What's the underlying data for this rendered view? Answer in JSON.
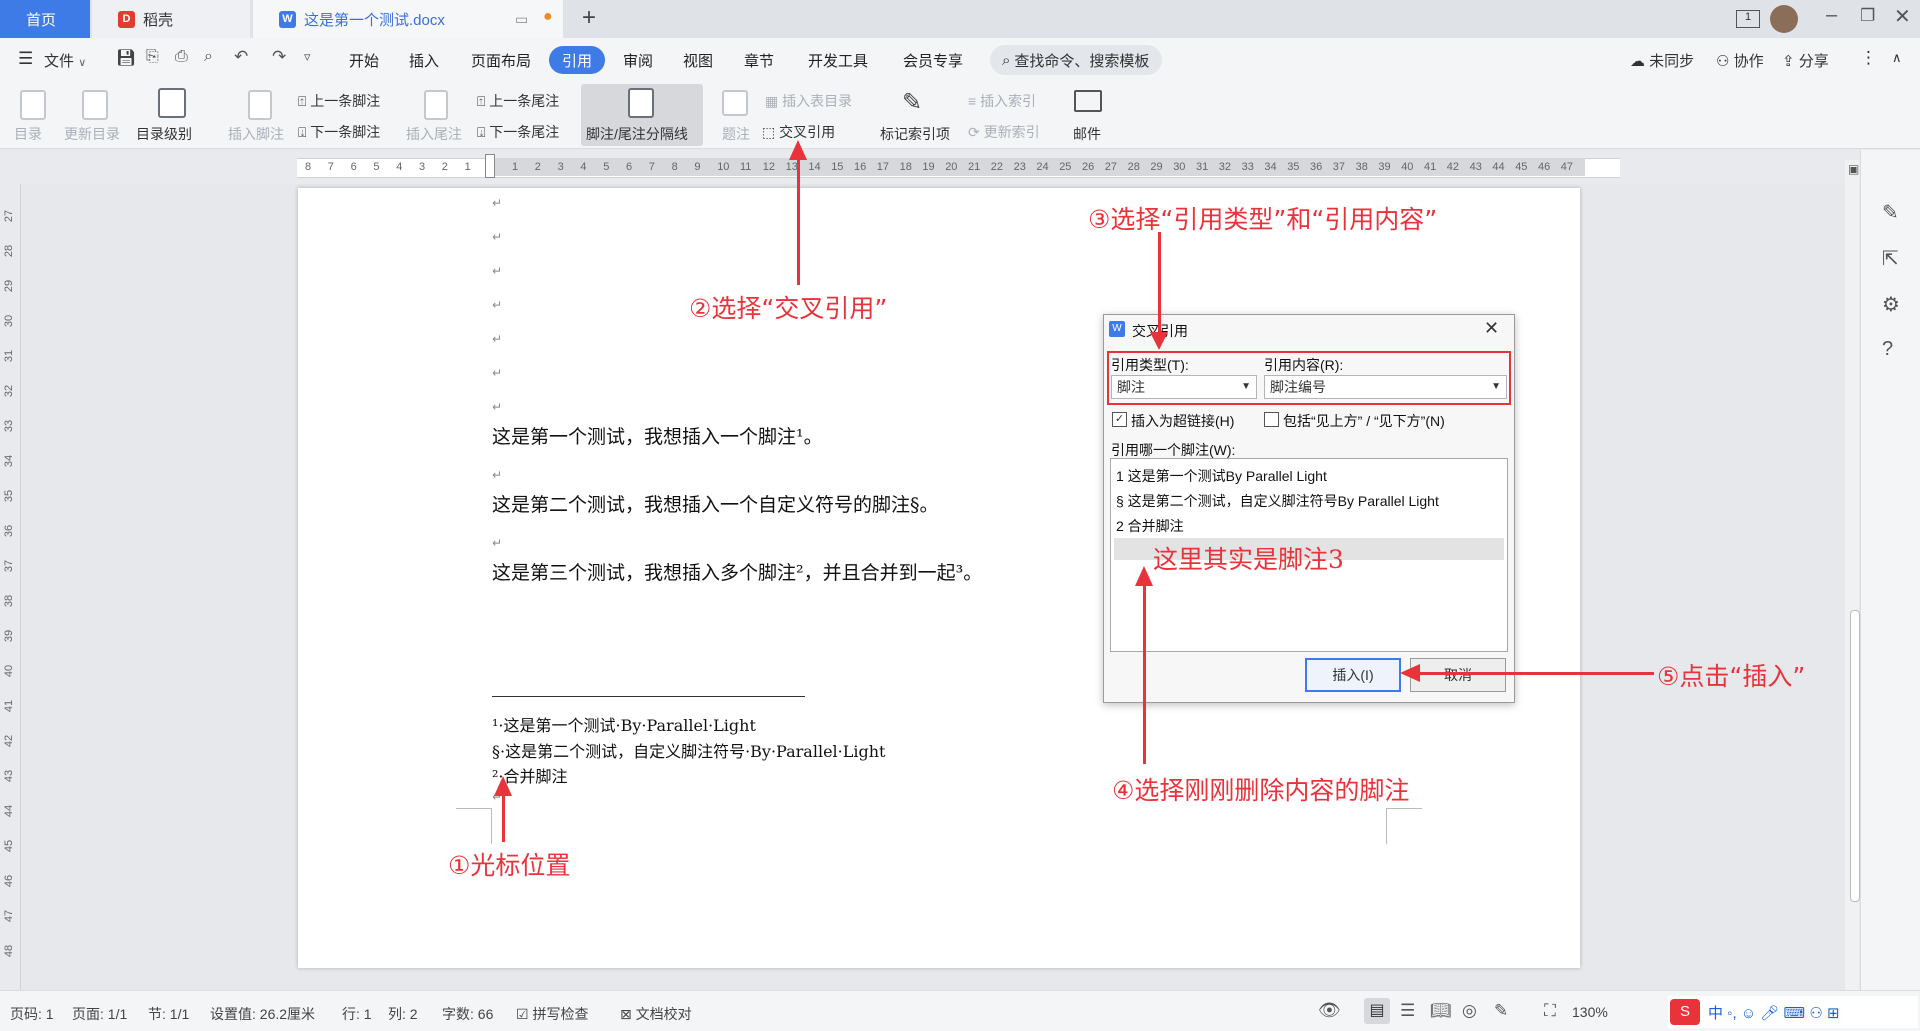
{
  "tabs": {
    "home": "首页",
    "daoke": "稻壳",
    "doc": "这是第一个测试.docx"
  },
  "menubar": {
    "file": "文件",
    "items": [
      "开始",
      "插入",
      "页面布局",
      "引用",
      "审阅",
      "视图",
      "章节",
      "开发工具",
      "会员专享"
    ],
    "search": "查找命令、搜索模板",
    "sync": "未同步",
    "collab": "协作",
    "share": "分享"
  },
  "ribbon": {
    "toc": "目录",
    "update_toc": "更新目录",
    "toc_level": "目录级别",
    "insert_footnote": "插入脚注",
    "prev_footnote": "上一条脚注",
    "next_footnote": "下一条脚注",
    "insert_endnote": "插入尾注",
    "prev_endnote": "上一条尾注",
    "next_endnote": "下一条尾注",
    "separator": "脚注/尾注分隔线",
    "caption": "题注",
    "insert_table_toc": "插入表目录",
    "cross_ref": "交叉引用",
    "mark_index": "标记索引项",
    "insert_index": "插入索引",
    "update_index": "更新索引",
    "mail": "邮件"
  },
  "ruler_left": [
    "8",
    "7",
    "6",
    "5",
    "4",
    "3",
    "2",
    "1"
  ],
  "ruler_right": [
    "1",
    "2",
    "3",
    "4",
    "5",
    "6",
    "7",
    "8",
    "9",
    "10",
    "11",
    "12",
    "13",
    "14",
    "15",
    "16",
    "17",
    "18",
    "19",
    "20",
    "21",
    "22",
    "23",
    "24",
    "25",
    "26",
    "27",
    "28",
    "29",
    "30",
    "31",
    "32",
    "33",
    "34",
    "35",
    "36",
    "37",
    "38",
    "39",
    "40",
    "41",
    "42",
    "43",
    "44",
    "45",
    "46",
    "47"
  ],
  "vruler": [
    "27",
    "28",
    "29",
    "30",
    "31",
    "32",
    "33",
    "34",
    "35",
    "36",
    "37",
    "38",
    "39",
    "40",
    "41",
    "42",
    "43",
    "44",
    "45",
    "46",
    "47",
    "48"
  ],
  "document": {
    "line1": "这是第一个测试，我想插入一个脚注¹。",
    "line2": "这是第二个测试，我想插入一个自定义符号的脚注§。",
    "line3": "这是第三个测试，我想插入多个脚注²，并且合并到一起³。",
    "fn1": "¹·这是第一个测试·By·Parallel·Light",
    "fn2": "§·这是第二个测试，自定义脚注符号·By·Parallel·Light",
    "fn3": "²·合并脚注"
  },
  "dialog": {
    "title": "交叉引用",
    "ref_type_label": "引用类型(T):",
    "ref_type_value": "脚注",
    "ref_content_label": "引用内容(R):",
    "ref_content_value": "脚注编号",
    "hyperlink": "插入为超链接(H)",
    "above_below": "包括“见上方” / “见下方”(N)",
    "which_label": "引用哪一个脚注(W):",
    "items": [
      "1 这是第一个测试By Parallel Light",
      "§ 这是第二个测试，自定义脚注符号By Parallel Light",
      "2 合并脚注"
    ],
    "insert": "插入(I)",
    "cancel": "取消"
  },
  "annotations": {
    "a1": "①光标位置",
    "a2": "②选择“交叉引用”",
    "a3": "③选择“引用类型”和“引用内容”",
    "a4": "④选择刚刚删除内容的脚注",
    "a5": "⑤点击“插入”",
    "note": "这里其实是脚注3"
  },
  "status": {
    "page": "页码: 1",
    "pages": "页面: 1/1",
    "section": "节: 1/1",
    "setting": "设置值: 26.2厘米",
    "row": "行: 1",
    "col": "列: 2",
    "words": "字数: 66",
    "spell": "拼写检查",
    "proof": "文档校对",
    "zoom": "130%"
  },
  "colors": {
    "accent": "#3f7be6",
    "annotation": "#e8333a"
  }
}
